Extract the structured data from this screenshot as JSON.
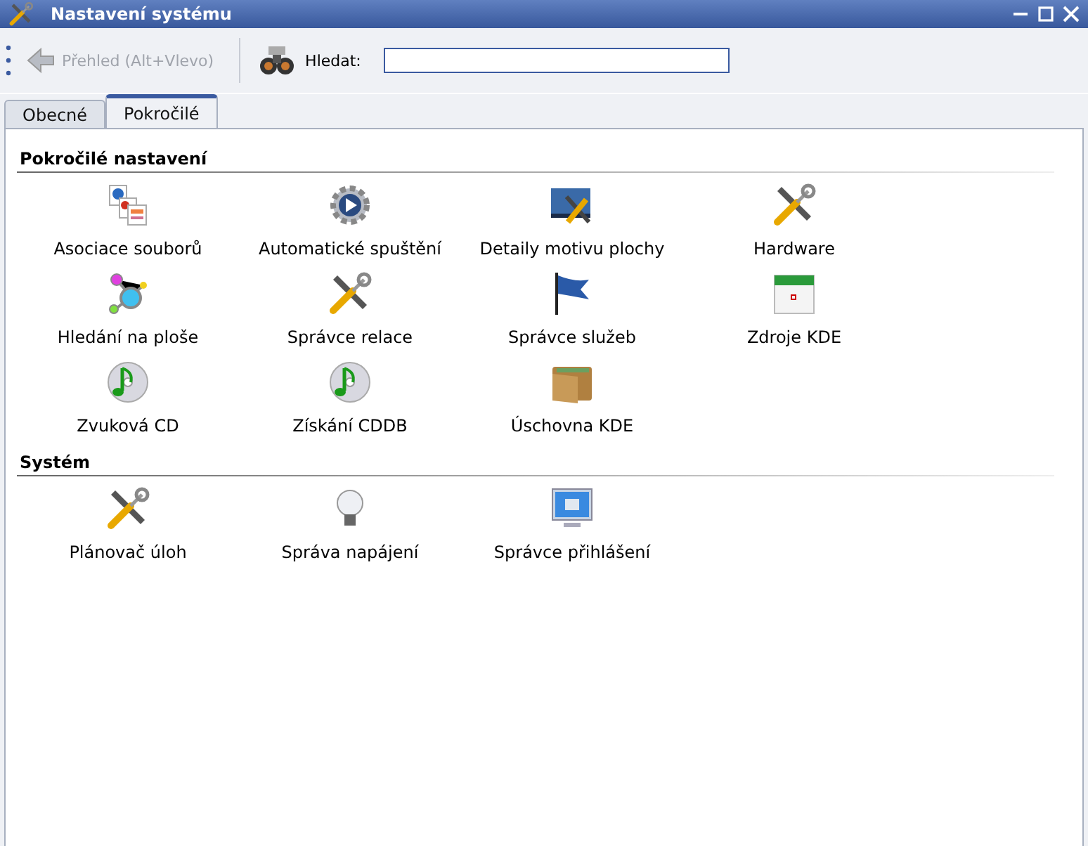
{
  "window": {
    "title": "Nastavení systému"
  },
  "toolbar": {
    "back": {
      "label": "Přehled (Alt+Vlevo)",
      "disabled": true
    },
    "search": {
      "label": "Hledat:"
    }
  },
  "tabs": [
    {
      "label": "Obecné",
      "selected": false
    },
    {
      "label": "Pokročilé",
      "selected": true
    }
  ],
  "sections": [
    {
      "title": "Pokročilé nastavení",
      "items": [
        {
          "label": "Asociace souborů"
        },
        {
          "label": "Automatické spuštění"
        },
        {
          "label": "Detaily motivu plochy"
        },
        {
          "label": "Hardware"
        },
        {
          "label": "Hledání na ploše"
        },
        {
          "label": "Správce relace"
        },
        {
          "label": "Správce služeb"
        },
        {
          "label": "Zdroje KDE"
        },
        {
          "label": "Zvuková CD"
        },
        {
          "label": "Získání CDDB"
        },
        {
          "label": "Úschovna KDE"
        }
      ]
    },
    {
      "title": "Systém",
      "items": [
        {
          "label": "Plánovač úloh"
        },
        {
          "label": "Správa napájení"
        },
        {
          "label": "Správce přihlášení"
        }
      ]
    }
  ]
}
